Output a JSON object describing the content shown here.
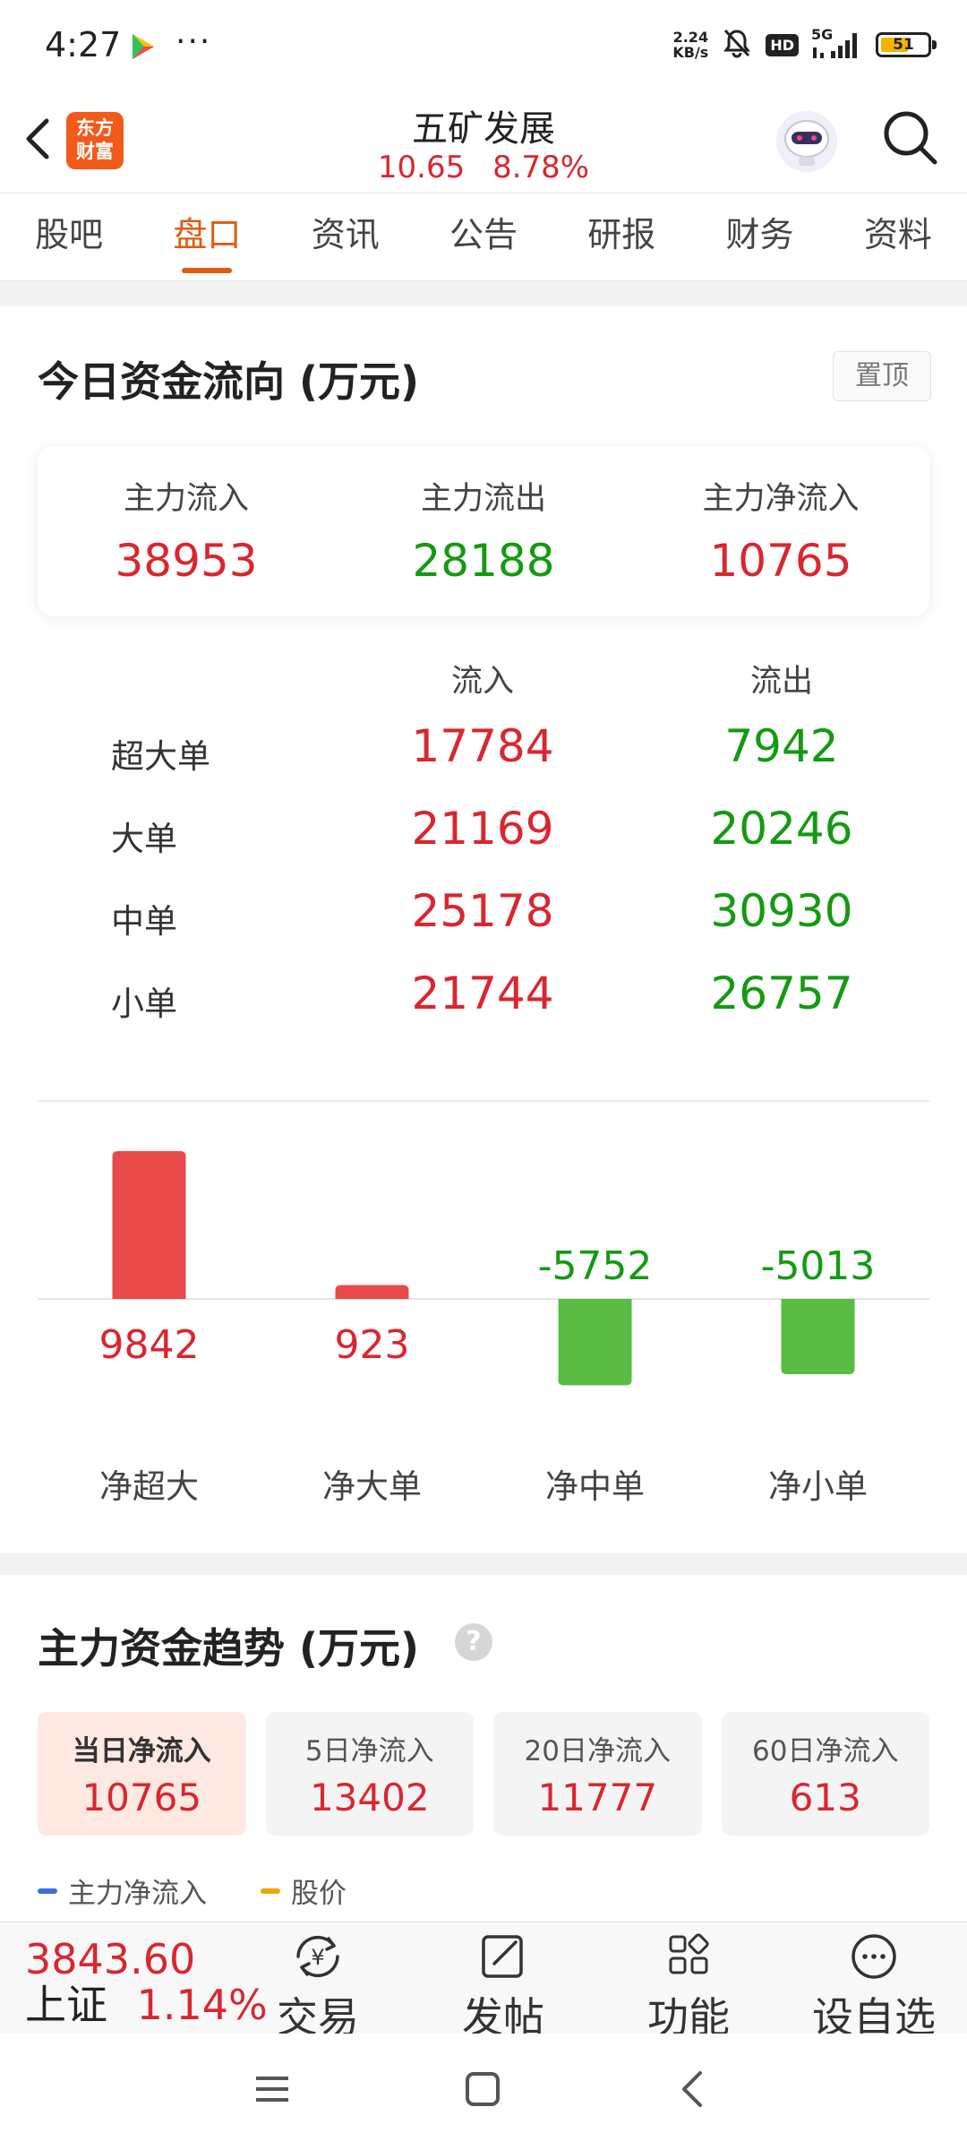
{
  "status_bar": {
    "time": "4:27",
    "net_speed_value": "2.24",
    "net_speed_unit": "KB/s",
    "hd_badge": "HD",
    "network": "5G",
    "battery": "51",
    "icons": [
      "play-store-icon",
      "more-dots-icon",
      "bell-off-icon",
      "signal-icon",
      "battery-icon"
    ]
  },
  "header": {
    "logo_line1": "东方",
    "logo_line2": "财富",
    "stock_name": "五矿发展",
    "price": "10.65",
    "change_pct": "8.78%"
  },
  "tabs": [
    {
      "label": "股吧",
      "active": false
    },
    {
      "label": "盘口",
      "active": true
    },
    {
      "label": "资讯",
      "active": false
    },
    {
      "label": "公告",
      "active": false
    },
    {
      "label": "研报",
      "active": false
    },
    {
      "label": "财务",
      "active": false
    },
    {
      "label": "资料",
      "active": false
    }
  ],
  "fund_flow": {
    "title": "今日资金流向 (万元)",
    "pin_label": "置顶",
    "summary": [
      {
        "label": "主力流入",
        "value": "38953",
        "color": "red"
      },
      {
        "label": "主力流出",
        "value": "28188",
        "color": "green"
      },
      {
        "label": "主力净流入",
        "value": "10765",
        "color": "red"
      }
    ],
    "table": {
      "col_in": "流入",
      "col_out": "流出",
      "rows": [
        {
          "label": "超大单",
          "in": "17784",
          "out": "7942"
        },
        {
          "label": "大单",
          "in": "21169",
          "out": "20246"
        },
        {
          "label": "中单",
          "in": "25178",
          "out": "30930"
        },
        {
          "label": "小单",
          "in": "21744",
          "out": "26757"
        }
      ]
    }
  },
  "chart_data": {
    "type": "bar",
    "categories": [
      "净超大",
      "净大单",
      "净中单",
      "净小单"
    ],
    "values": [
      9842,
      923,
      -5752,
      -5013
    ],
    "value_labels": [
      "9842",
      "923",
      "-5752",
      "-5013"
    ],
    "positive_color": "#e84a4a",
    "negative_color": "#5abc44",
    "positive_label_color": "#d9262f",
    "negative_label_color": "#149a12"
  },
  "trend": {
    "title": "主力资金趋势 (万元)",
    "periods": [
      {
        "label": "当日净流入",
        "value": "10765",
        "active": true
      },
      {
        "label": "5日净流入",
        "value": "13402",
        "active": false
      },
      {
        "label": "20日净流入",
        "value": "11777",
        "active": false
      },
      {
        "label": "60日净流入",
        "value": "613",
        "active": false
      }
    ],
    "legend": [
      {
        "label": "主力净流入",
        "color": "#3d6fe0"
      },
      {
        "label": "股价",
        "color": "#f0a500"
      }
    ]
  },
  "toolbar": {
    "index_value": "3843.60",
    "index_name": "上证",
    "index_change": "1.14%",
    "items": [
      {
        "label": "交易",
        "icon": "yen-exchange-icon"
      },
      {
        "label": "发帖",
        "icon": "edit-post-icon"
      },
      {
        "label": "功能",
        "icon": "grid-apps-icon"
      },
      {
        "label": "设自选",
        "icon": "more-circle-icon"
      }
    ]
  },
  "nav_bar": {
    "icons": [
      "menu-icon",
      "home-square-icon",
      "back-chevron-icon"
    ]
  }
}
